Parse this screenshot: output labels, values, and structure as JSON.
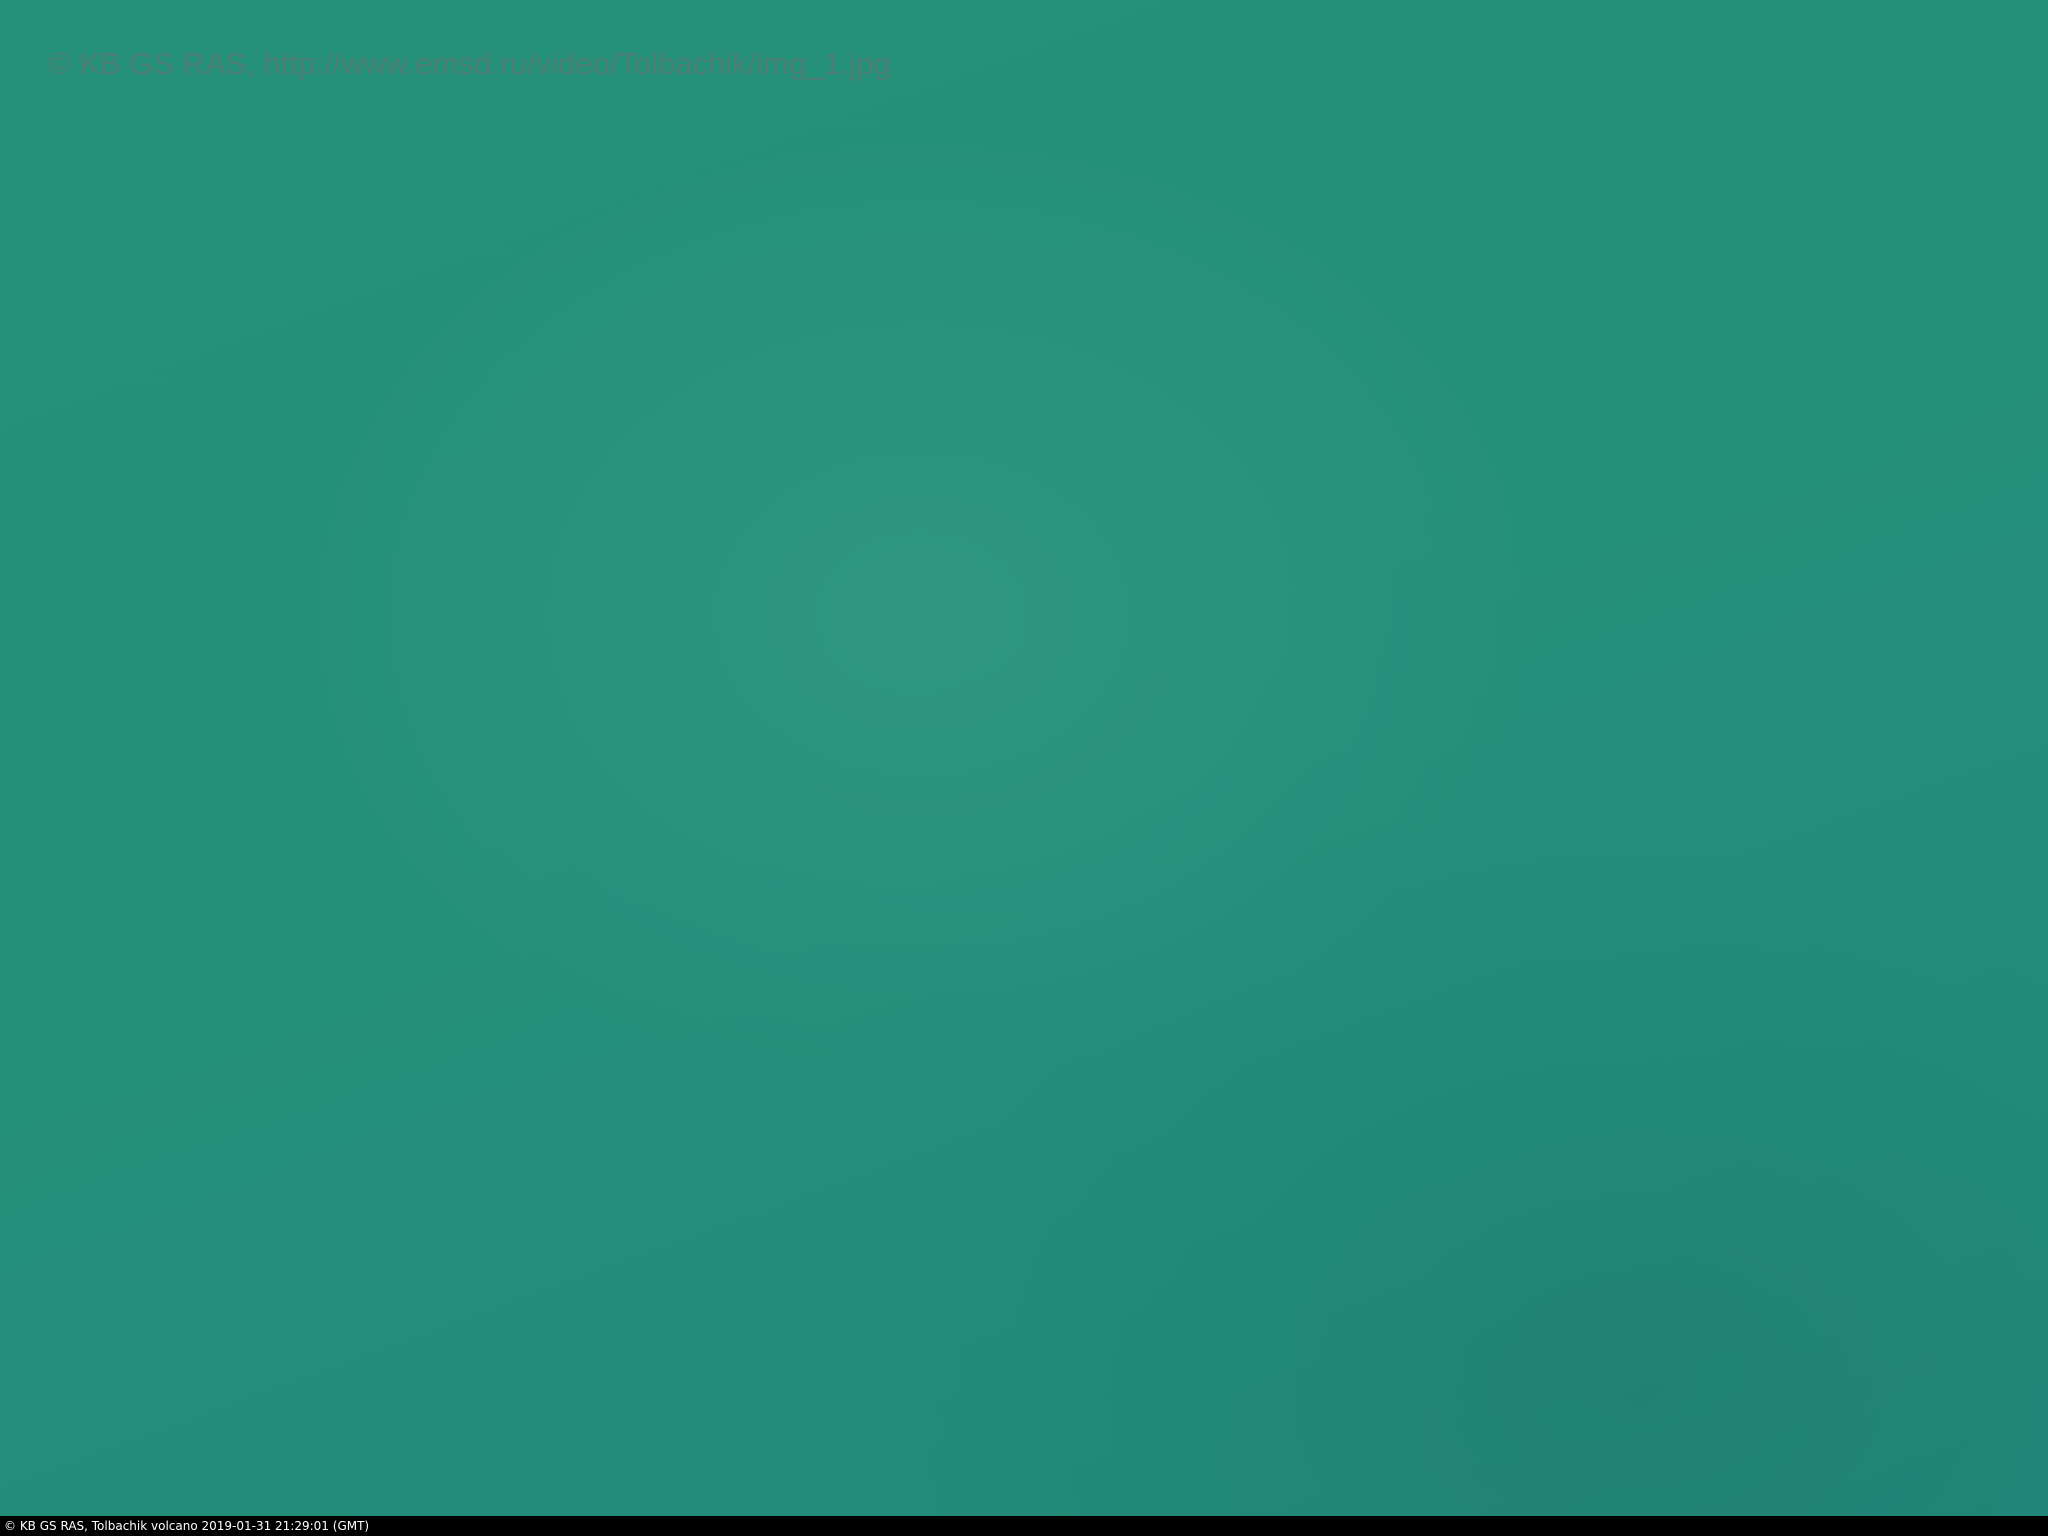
{
  "image": {
    "watermark": "© KB GS RAS, http://www.emsd.ru/video/Tolbachik/img_1.jpg",
    "caption": "© KB GS RAS, Tolbachik volcano 2019-01-31 21:29:01 (GMT)",
    "colors": {
      "sky": "#23907a",
      "watermark_text": "#4e7f76",
      "caption_bar": "#000000",
      "caption_text": "#ffffff"
    }
  }
}
